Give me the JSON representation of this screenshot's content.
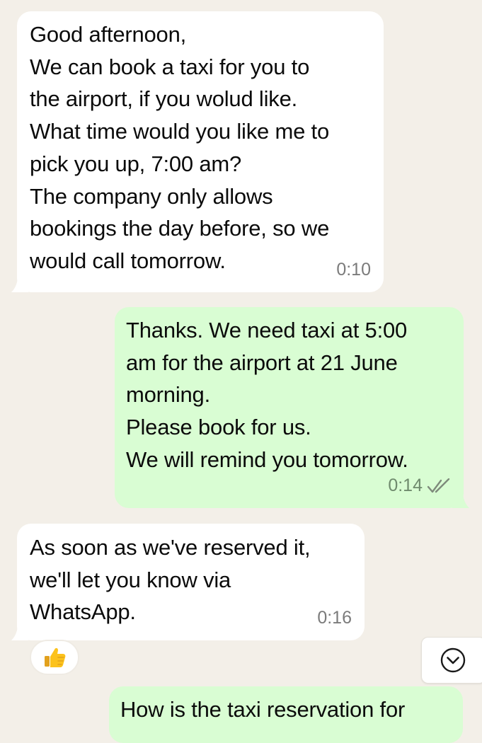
{
  "messages": [
    {
      "direction": "incoming",
      "text": "Good afternoon,\nWe can book a taxi for you to\nthe airport, if you wolud  like.\nWhat time would you like me to\npick you up, 7:00 am?\nThe company only allows\nbookings the day before, so we\nwould  call tomorrow.",
      "time": "0:10"
    },
    {
      "direction": "outgoing",
      "text": "Thanks. We need taxi at 5:00\nam for the airport at 21 June\nmorning.\nPlease book for us.\nWe will remind you tomorrow.",
      "time": "0:14",
      "status_icon": "double-check-read"
    },
    {
      "direction": "incoming",
      "text": "As soon as we've reserved it,\nwe'll let you know via\nWhatsApp.",
      "time": "0:16",
      "reaction": "thumbs-up"
    },
    {
      "direction": "outgoing",
      "text": "How is the taxi reservation for"
    }
  ],
  "scroll_button_icon": "chevron-down-circle",
  "colors": {
    "background": "#f3efe8",
    "incoming_bubble": "#ffffff",
    "outgoing_bubble": "#d9fdd3",
    "timestamp": "#7b7b7b"
  }
}
